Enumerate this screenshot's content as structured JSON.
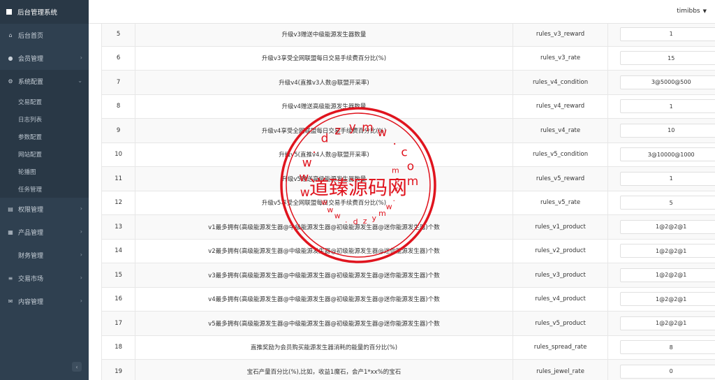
{
  "brand": {
    "title": "后台管理系统"
  },
  "user": {
    "name": "timibbs"
  },
  "sidebar": {
    "items": [
      {
        "label": "后台首页",
        "icon": "home-icon",
        "glyph": "⌂",
        "arrow": false
      },
      {
        "label": "会员管理",
        "icon": "user-icon",
        "glyph": "●",
        "arrow": true
      },
      {
        "label": "系统配置",
        "icon": "cogs-icon",
        "glyph": "⚙",
        "arrow": true,
        "open": true
      },
      {
        "label": "权限管理",
        "icon": "shield-icon",
        "glyph": "▤",
        "arrow": true
      },
      {
        "label": "产品管理",
        "icon": "windows-icon",
        "glyph": "▦",
        "arrow": true
      },
      {
        "label": "财务管理",
        "icon": "",
        "glyph": "",
        "arrow": true
      },
      {
        "label": "交易市场",
        "icon": "list-icon",
        "glyph": "≡",
        "arrow": true
      },
      {
        "label": "内容管理",
        "icon": "envelope-icon",
        "glyph": "✉",
        "arrow": true
      }
    ],
    "submenu": [
      "交易配置",
      "日志列表",
      "参数配置",
      "网站配置",
      "轮播图",
      "任务管理"
    ],
    "collapse_glyph": "‹"
  },
  "table": {
    "button_label": "确认修改",
    "rows": [
      {
        "id": "5",
        "desc": "升级v3赠送中级能源发生器数量",
        "key": "rules_v3_reward",
        "value": "1"
      },
      {
        "id": "6",
        "desc": "升级v3享受全网联盟每日交易手续费百分比(%)",
        "key": "rules_v3_rate",
        "value": "15"
      },
      {
        "id": "7",
        "desc": "升级v4(直推v3人数@联盟开采率)",
        "key": "rules_v4_condition",
        "value": "3@5000@500"
      },
      {
        "id": "8",
        "desc": "升级v4赠送高级能源发生器数量",
        "key": "rules_v4_reward",
        "value": "1"
      },
      {
        "id": "9",
        "desc": "升级v4享受全网联盟每日交易手续费百分比(%)",
        "key": "rules_v4_rate",
        "value": "10"
      },
      {
        "id": "10",
        "desc": "升级v5(直推v4人数@联盟开采率)",
        "key": "rules_v5_condition",
        "value": "3@10000@1000"
      },
      {
        "id": "11",
        "desc": "升级v5赠送高级能源发生器数量",
        "key": "rules_v5_reward",
        "value": "1"
      },
      {
        "id": "12",
        "desc": "升级v5享受全网联盟每日交易手续费百分比(%)",
        "key": "rules_v5_rate",
        "value": "5"
      },
      {
        "id": "13",
        "desc": "v1最多拥有(高级能源发生器@中级能源发生器@初级能源发生器@迷你能源发生器)个数",
        "key": "rules_v1_product",
        "value": "1@2@2@1"
      },
      {
        "id": "14",
        "desc": "v2最多拥有(高级能源发生器@中级能源发生器@初级能源发生器@迷你能源发生器)个数",
        "key": "rules_v2_product",
        "value": "1@2@2@1"
      },
      {
        "id": "15",
        "desc": "v3最多拥有(高级能源发生器@中级能源发生器@初级能源发生器@迷你能源发生器)个数",
        "key": "rules_v3_product",
        "value": "1@2@2@1"
      },
      {
        "id": "16",
        "desc": "v4最多拥有(高级能源发生器@中级能源发生器@初级能源发生器@迷你能源发生器)个数",
        "key": "rules_v4_product",
        "value": "1@2@2@1"
      },
      {
        "id": "17",
        "desc": "v5最多拥有(高级能源发生器@中级能源发生器@初级能源发生器@迷你能源发生器)个数",
        "key": "rules_v5_product",
        "value": "1@2@2@1"
      },
      {
        "id": "18",
        "desc": "直推奖励为会员购买能源发生器消耗的能量的百分比(%)",
        "key": "rules_spread_rate",
        "value": "8"
      },
      {
        "id": "19",
        "desc": "宝石产量百分比(%),比如，收益1魔石，会产1*xx%的宝石",
        "key": "rules_jewel_rate",
        "value": "0"
      }
    ]
  },
  "watermark": {
    "text": "道臻源码网",
    "color": "#e0141e"
  }
}
